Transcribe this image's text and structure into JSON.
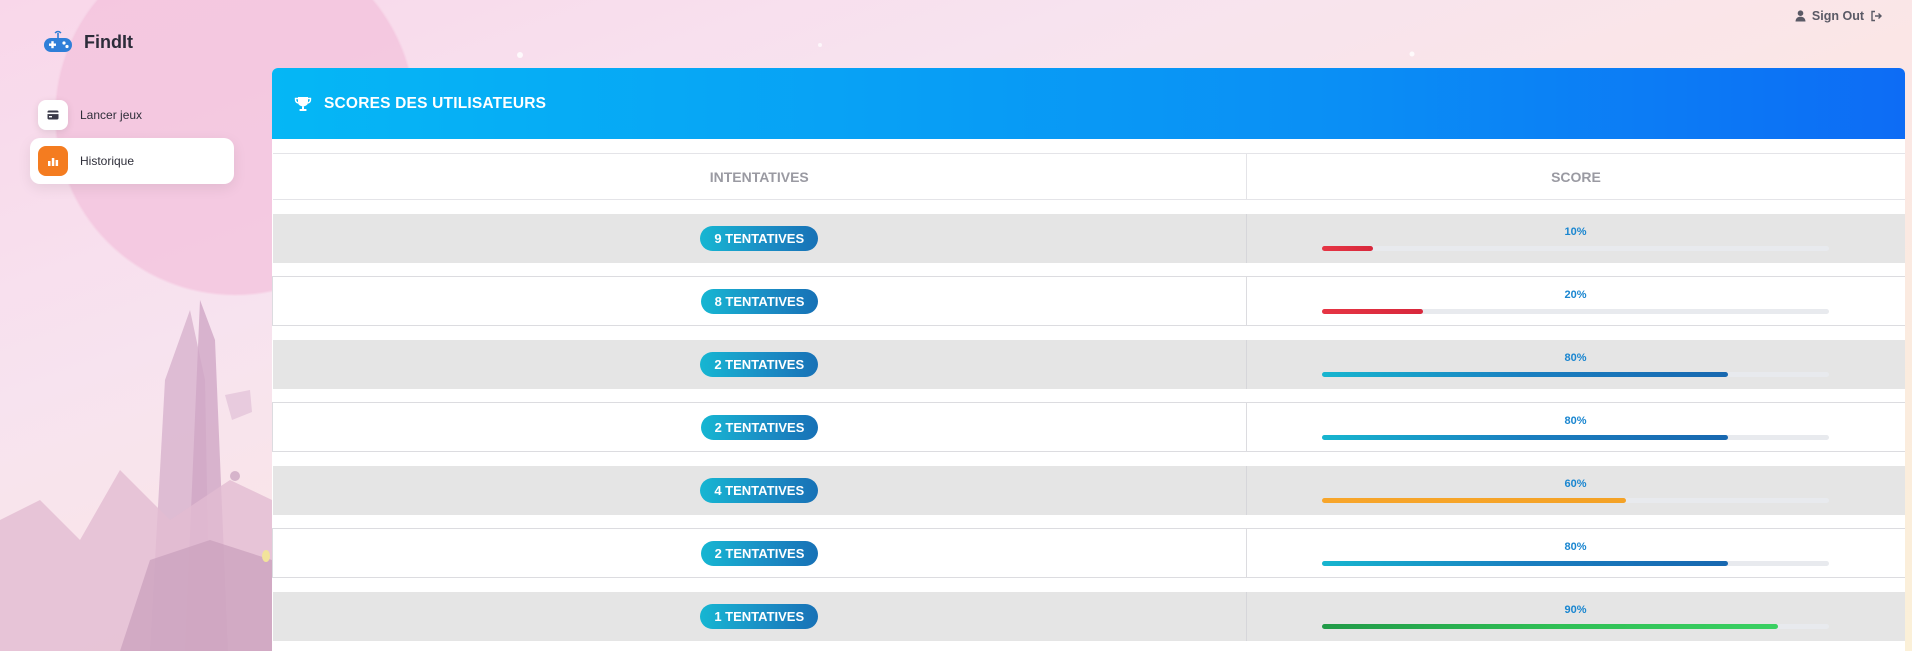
{
  "app": {
    "name": "FindIt"
  },
  "topbar": {
    "signout_label": "Sign Out"
  },
  "sidebar": {
    "items": [
      {
        "label": "Lancer jeux",
        "icon": "card-icon",
        "active": false
      },
      {
        "label": "Historique",
        "icon": "chart-icon",
        "active": true
      }
    ]
  },
  "card": {
    "title": "SCORES DES UTILISATEURS",
    "icon": "trophy-icon"
  },
  "table": {
    "headers": [
      "INTENTATIVES",
      "SCORE"
    ],
    "rows": [
      {
        "attempts": "9 TENTATIVES",
        "score_label": "10%",
        "score": 10,
        "color": "red"
      },
      {
        "attempts": "8 TENTATIVES",
        "score_label": "20%",
        "score": 20,
        "color": "red"
      },
      {
        "attempts": "2 TENTATIVES",
        "score_label": "80%",
        "score": 80,
        "color": "blue"
      },
      {
        "attempts": "2 TENTATIVES",
        "score_label": "80%",
        "score": 80,
        "color": "blue"
      },
      {
        "attempts": "4 TENTATIVES",
        "score_label": "60%",
        "score": 60,
        "color": "orange"
      },
      {
        "attempts": "2 TENTATIVES",
        "score_label": "80%",
        "score": 80,
        "color": "blue"
      },
      {
        "attempts": "1 TENTATIVES",
        "score_label": "90%",
        "score": 90,
        "color": "green"
      }
    ]
  },
  "colors": {
    "accent": "#0a8ff5",
    "active_nav": "#f47c20",
    "low": "#e63544",
    "medium": "#f4a226",
    "good": "#1a7fc0",
    "high": "#2fbf55"
  }
}
